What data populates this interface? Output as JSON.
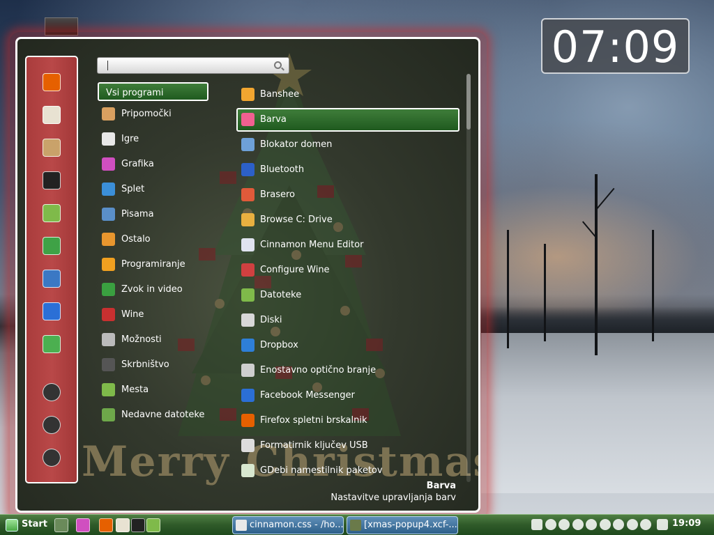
{
  "desktop": {
    "clock_desklet": "07:09"
  },
  "menu": {
    "background_text": "Merry Christmas",
    "search": {
      "value": "",
      "placeholder": ""
    },
    "favorites": [
      {
        "name": "firefox-icon",
        "color": "#e66000"
      },
      {
        "name": "clapper-icon",
        "color": "#e8e2d2"
      },
      {
        "name": "package-icon",
        "color": "#c9a26a"
      },
      {
        "name": "terminal-icon",
        "color": "#222222"
      },
      {
        "name": "folder-icon",
        "color": "#7fba4a"
      },
      {
        "name": "magnifier-icon",
        "color": "#3fa246"
      },
      {
        "name": "game-icon",
        "color": "#3b78c4"
      },
      {
        "name": "messenger-icon",
        "color": "#2b6fd6"
      },
      {
        "name": "hashtag-icon",
        "color": "#4caf50"
      },
      {
        "name": "lock-icon",
        "color": "#333333"
      },
      {
        "name": "logout-icon",
        "color": "#333333"
      },
      {
        "name": "power-icon",
        "color": "#333333"
      }
    ],
    "categories": [
      {
        "label": "Vsi programi",
        "selected": true,
        "icon": "",
        "color": ""
      },
      {
        "label": "Pripomočki",
        "icon": "calculator-icon",
        "color": "#d9a060"
      },
      {
        "label": "Igre",
        "icon": "dice-icon",
        "color": "#e8e8e8"
      },
      {
        "label": "Grafika",
        "icon": "palette-icon",
        "color": "#d04fc0"
      },
      {
        "label": "Splet",
        "icon": "globe-icon",
        "color": "#3b8fd8"
      },
      {
        "label": "Pisama",
        "icon": "office-icon",
        "color": "#5a8fc8"
      },
      {
        "label": "Ostalo",
        "icon": "misc-icon",
        "color": "#e8962e"
      },
      {
        "label": "Programiranje",
        "icon": "construction-icon",
        "color": "#f0a020"
      },
      {
        "label": "Zvok in video",
        "icon": "film-icon",
        "color": "#3aa040"
      },
      {
        "label": "Wine",
        "icon": "wine-icon",
        "color": "#c83030"
      },
      {
        "label": "Možnosti",
        "icon": "sliders-icon",
        "color": "#bbbbbb"
      },
      {
        "label": "Skrbništvo",
        "icon": "admin-icon",
        "color": "#555555"
      },
      {
        "label": "Mesta",
        "icon": "places-folder-icon",
        "color": "#7fba4a"
      },
      {
        "label": "Nedavne datoteke",
        "icon": "recent-folder-icon",
        "color": "#6ea84a"
      }
    ],
    "apps": [
      {
        "label": "Banshee",
        "icon": "banshee-icon",
        "color": "#f2a630"
      },
      {
        "label": "Barva",
        "icon": "color-flower-icon",
        "color": "#f06090",
        "selected": true
      },
      {
        "label": "Blokator domen",
        "icon": "blocker-icon",
        "color": "#6ea0d8"
      },
      {
        "label": "Bluetooth",
        "icon": "bluetooth-icon",
        "color": "#2c60c8"
      },
      {
        "label": "Brasero",
        "icon": "disc-burner-icon",
        "color": "#e05a3a"
      },
      {
        "label": "Browse C: Drive",
        "icon": "wine-drive-icon",
        "color": "#e8b040"
      },
      {
        "label": "Cinnamon Menu Editor",
        "icon": "menu-editor-icon",
        "color": "#e0e4f0"
      },
      {
        "label": "Configure Wine",
        "icon": "wine-config-icon",
        "color": "#d04040"
      },
      {
        "label": "Datoteke",
        "icon": "files-folder-icon",
        "color": "#7fba4a"
      },
      {
        "label": "Diski",
        "icon": "disks-icon",
        "color": "#d8d8d8"
      },
      {
        "label": "Dropbox",
        "icon": "dropbox-icon",
        "color": "#2e7fd8"
      },
      {
        "label": "Enostavno optično branje",
        "icon": "scanner-icon",
        "color": "#cfcfcf"
      },
      {
        "label": "Facebook Messenger",
        "icon": "messenger-app-icon",
        "color": "#2b6fd6"
      },
      {
        "label": "Firefox spletni brskalnik",
        "icon": "firefox-app-icon",
        "color": "#e66000"
      },
      {
        "label": "Formatirnik ključev USB",
        "icon": "usb-icon",
        "color": "#dddddd"
      },
      {
        "label": "GDebi namestilnik paketov",
        "icon": "gdebi-icon",
        "color": "#d8e8d0"
      }
    ],
    "description": {
      "title": "Barva",
      "body": "Nastavitve upravljanja barv"
    }
  },
  "panel": {
    "start_label": "Start",
    "launchers": [
      {
        "name": "file-manager-launcher-icon",
        "color": "#6a8a5a"
      },
      {
        "name": "color-launcher-icon",
        "color": "#d04fc0"
      },
      {
        "name": "firefox-launcher-icon",
        "color": "#e66000"
      },
      {
        "name": "clapper-launcher-icon",
        "color": "#e8e2d2"
      },
      {
        "name": "terminal-launcher-icon",
        "color": "#222222"
      },
      {
        "name": "folder-launcher-icon",
        "color": "#7fba4a"
      }
    ],
    "tasks": [
      {
        "label": "cinnamon.css - /ho...",
        "icon": "editor-task-icon",
        "color": "#e8e8e8"
      },
      {
        "label": "[xmas-popup4.xcf-...",
        "icon": "gimp-task-icon",
        "color": "#6a7a4a"
      }
    ],
    "tray": [
      "camera-icon",
      "search-tray-icon",
      "workspace-icon",
      "user-icon",
      "screen-icon",
      "skype-icon",
      "pen-icon",
      "volume-icon",
      "network-icon",
      "shield-icon"
    ],
    "time": "19:09"
  }
}
